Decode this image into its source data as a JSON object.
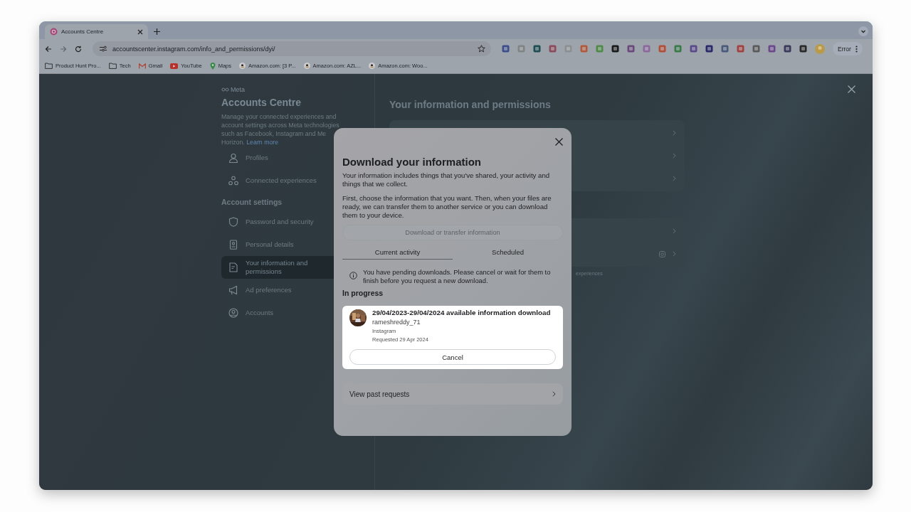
{
  "browser": {
    "tab": {
      "title": "Accounts Centre"
    },
    "address": "accountscenter.instagram.com/info_and_permissions/dyi/",
    "profile_button": "Error",
    "bookmarks": [
      {
        "label": "Product Hunt Pro...",
        "kind": "folder"
      },
      {
        "label": "Tech",
        "kind": "folder"
      },
      {
        "label": "Gmail",
        "kind": "gmail"
      },
      {
        "label": "YouTube",
        "kind": "youtube"
      },
      {
        "label": "Maps",
        "kind": "maps"
      },
      {
        "label": "Amazon.com: [3 P...",
        "kind": "amazon"
      },
      {
        "label": "Amazon.com: AZL...",
        "kind": "amazon"
      },
      {
        "label": "Amazon.com: Woo...",
        "kind": "amazon"
      }
    ]
  },
  "sidebar": {
    "brand": "Meta",
    "title": "Accounts Centre",
    "description": {
      "lines": [
        "Manage your connected experiences and",
        "account settings across Meta technologies",
        "such as Facebook, Instagram and Me",
        "Horizon."
      ],
      "link": "Learn more"
    },
    "nav": [
      {
        "kind": "item",
        "label": "Profiles",
        "selected": false
      },
      {
        "kind": "item",
        "label": "Connected experiences",
        "selected": false
      },
      {
        "kind": "heading",
        "label": "Account settings"
      },
      {
        "kind": "item",
        "label": "Password and security",
        "selected": false
      },
      {
        "kind": "item",
        "label": "Personal details",
        "selected": false
      },
      {
        "kind": "item",
        "label": "Your information and permissions",
        "selected": true
      },
      {
        "kind": "item",
        "label": "Ad preferences",
        "selected": false
      },
      {
        "kind": "item",
        "label": "Accounts",
        "selected": false
      }
    ]
  },
  "main": {
    "title": "Your information and permissions",
    "footnote": "experiences"
  },
  "modal": {
    "title": "Download your information",
    "paragraphs": [
      "Your information includes things that you've shared, your activity and things that we collect.",
      "First, choose the information that you want. Then, when your files are ready, we can transfer them to another service or you can download them to your device."
    ],
    "primary_button": {
      "label": "Download or transfer information",
      "disabled": true
    },
    "tabs": [
      {
        "label": "Current activity",
        "selected": true
      },
      {
        "label": "Scheduled",
        "selected": false
      }
    ],
    "notice": "You have pending downloads. Please cancel or wait for them to finish before you request a new download.",
    "section_title": "In progress",
    "requests": [
      {
        "title": "29/04/2023-29/04/2024 available information download",
        "account": "rameshreddy_71",
        "platform": "Instagram",
        "requested": "Requested 29 Apr 2024",
        "cancel": "Cancel"
      }
    ],
    "past_requests": "View past requests"
  }
}
